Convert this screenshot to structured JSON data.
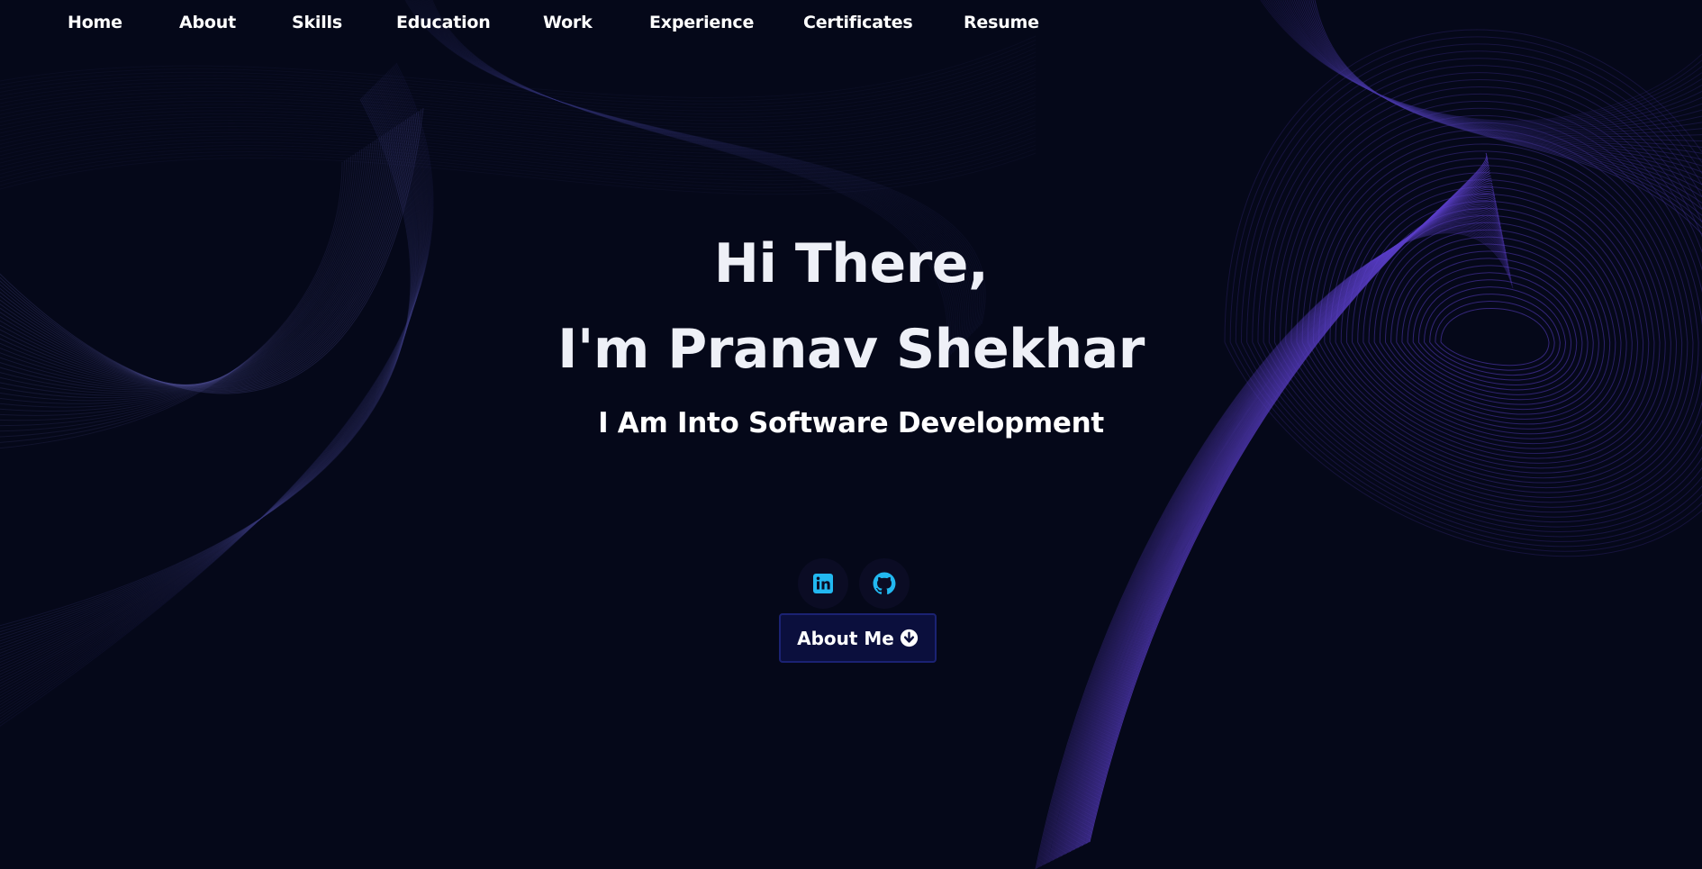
{
  "nav": {
    "items": [
      {
        "label": "Home"
      },
      {
        "label": "About"
      },
      {
        "label": "Skills"
      },
      {
        "label": "Education"
      },
      {
        "label": "Work"
      },
      {
        "label": "Experience"
      },
      {
        "label": "Certificates"
      },
      {
        "label": "Resume"
      }
    ]
  },
  "hero": {
    "greeting": "Hi There,",
    "name": "I'm Pranav Shekhar",
    "tagline": "I Am Into Software Development"
  },
  "social": {
    "linkedin_icon": "linkedin-icon",
    "github_icon": "github-icon",
    "icon_color": "#22b8f0"
  },
  "cta": {
    "about_label": "About Me",
    "icon": "circle-arrow-down-icon"
  },
  "colors": {
    "background": "#050819",
    "accent_purple": "#5b3fc9",
    "button_bg": "#0b0f3d"
  }
}
